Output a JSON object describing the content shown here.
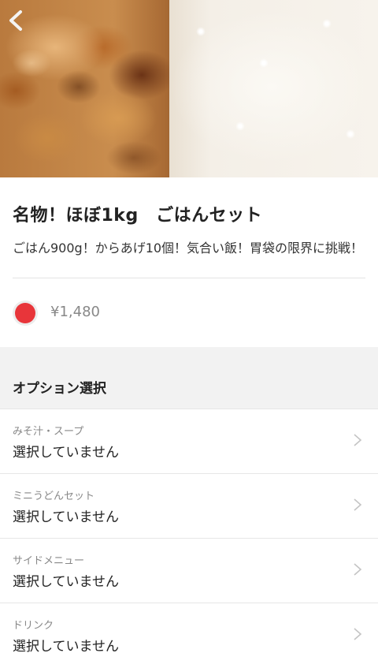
{
  "product": {
    "title": "名物！ほぼ1kg　ごはんセット",
    "description": "ごはん900g！からあげ10個！気合い飯！胃袋の限界に挑戦！",
    "price": "¥1,480"
  },
  "options": {
    "section_title": "オプション選択",
    "items": [
      {
        "category": "みそ汁・スープ",
        "value": "選択していません"
      },
      {
        "category": "ミニうどんセット",
        "value": "選択していません"
      },
      {
        "category": "サイドメニュー",
        "value": "選択していません"
      },
      {
        "category": "ドリンク",
        "value": "選択していません"
      }
    ]
  },
  "colors": {
    "accent": "#e8353a",
    "back_chevron": "#f2f2f2"
  }
}
